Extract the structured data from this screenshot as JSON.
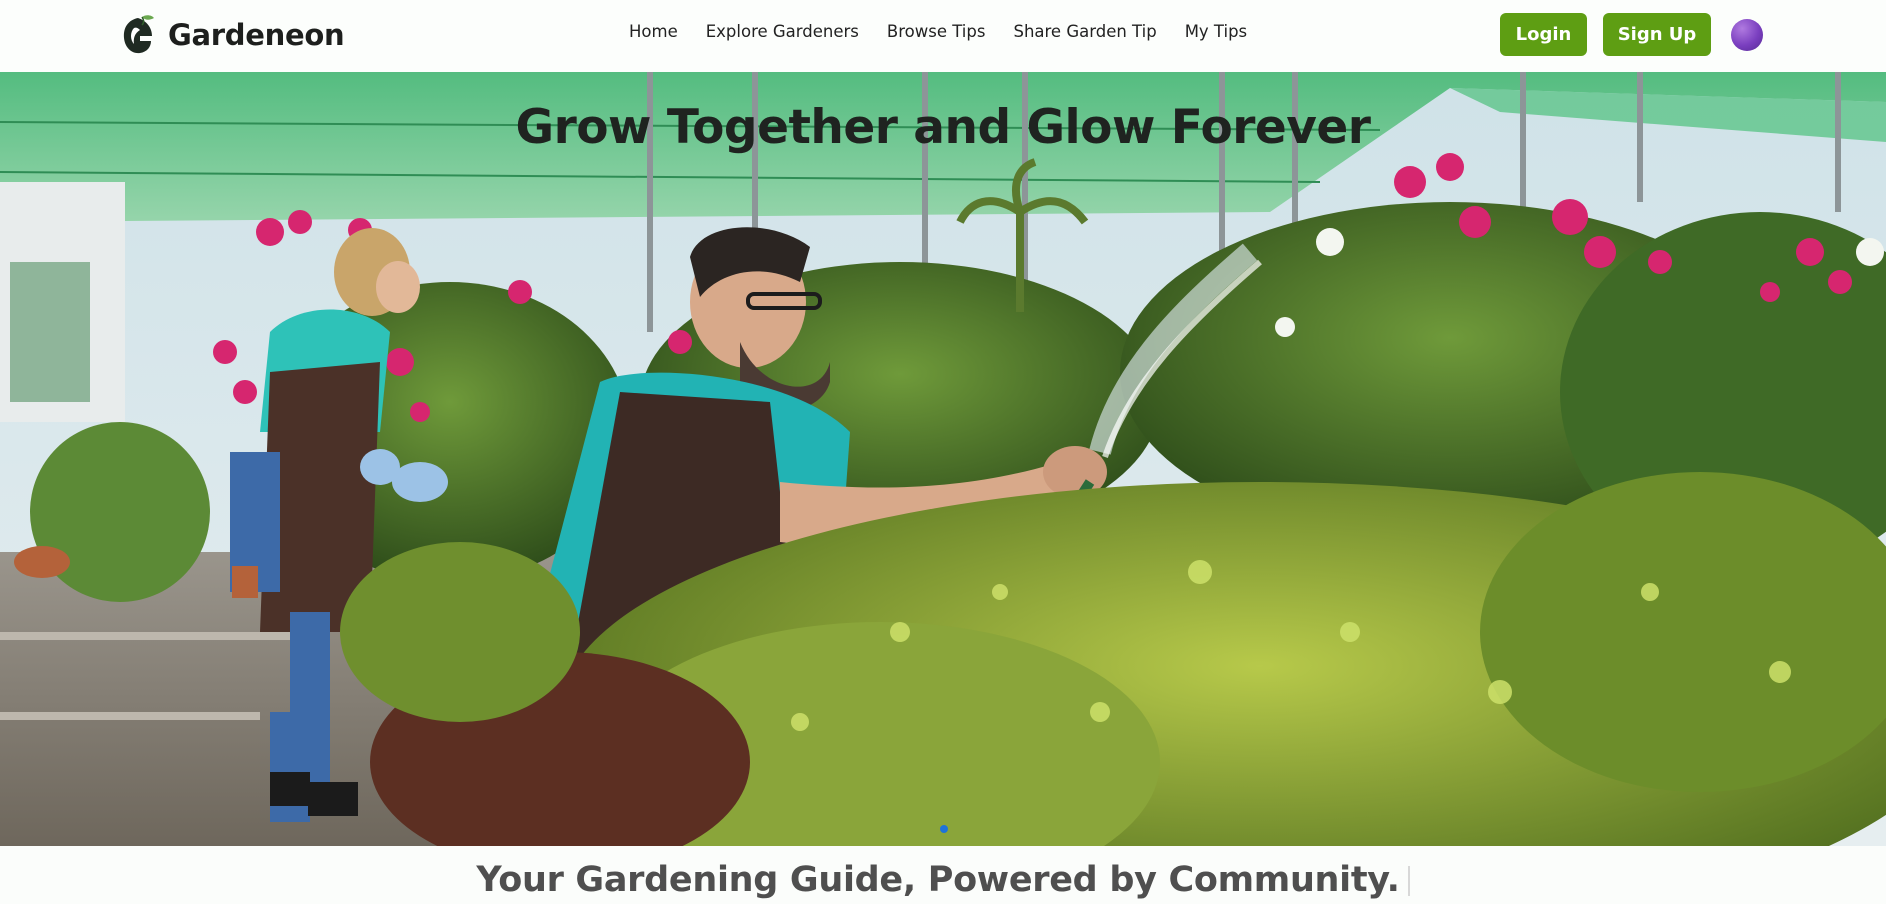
{
  "brand": {
    "name": "Gardeneon",
    "logo_icon": "leaf-g-logo-icon"
  },
  "nav": {
    "links": [
      "Home",
      "Explore Gardeners",
      "Browse Tips",
      "Share Garden Tip",
      "My Tips"
    ]
  },
  "auth": {
    "login_label": "Login",
    "signup_label": "Sign Up",
    "button_color": "#5e9e13"
  },
  "user": {
    "avatar_icon": "user-avatar-icon",
    "avatar_color": "#7a3fbf"
  },
  "hero": {
    "title": "Grow Together and Glow Forever",
    "image": "gardeners-watering-plants-photo",
    "active_slide": 1
  },
  "tagline": {
    "text": "Your Gardening Guide, Powered by Community."
  }
}
